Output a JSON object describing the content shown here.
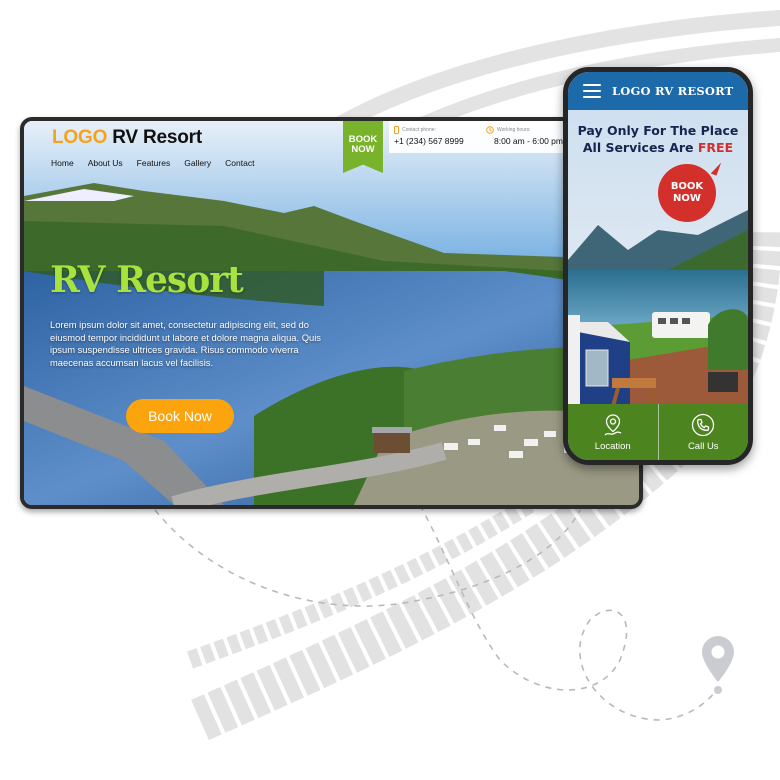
{
  "desktop": {
    "logo_accent": "LOGO",
    "logo_text": "RV Resort",
    "nav": [
      "Home",
      "About Us",
      "Features",
      "Gallery",
      "Contact"
    ],
    "ribbon_line1": "BOOK",
    "ribbon_line2": "NOW",
    "contact_phone_label": "Contact phone:",
    "contact_phone": "+1 (234) 567 8999",
    "hours_label": "Working hours:",
    "hours": "8:00 am - 6:00 pm",
    "hero_title": "RV Resort",
    "hero_text": "Lorem ipsum dolor sit amet, consectetur adipiscing elit, sed do eiusmod tempor incididunt ut labore et dolore magna aliqua. Quis ipsum suspendisse ultrices gravida. Risus commodo viverra maecenas accumsan lacus vel facilisis.",
    "book_button": "Book Now"
  },
  "phone": {
    "logo": "LOGO RV RESORT",
    "headline_line1": "Pay Only For The Place",
    "headline_line2_prefix": "All Services Are ",
    "headline_line2_accent": "FREE",
    "bubble_line1": "BOOK",
    "bubble_line2": "NOW",
    "footer": [
      {
        "label": "Location",
        "icon": "map-pin-icon"
      },
      {
        "label": "Call Us",
        "icon": "phone-icon"
      }
    ]
  },
  "colors": {
    "accent_orange": "#f6a21a",
    "ribbon_green": "#79b32b",
    "hero_title_green": "#a8e33d",
    "button_orange": "#fba40d",
    "phone_header_blue": "#1c6aa9",
    "phone_footer_green": "#4c841f",
    "bubble_red": "#d4302b",
    "headline_navy": "#14254f"
  }
}
